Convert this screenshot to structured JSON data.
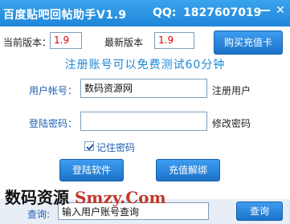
{
  "window": {
    "title": "百度贴吧回帖助手V1.9",
    "qq_label": "QQ:",
    "qq_value": "1827607019",
    "minimize_glyph": "—",
    "close_glyph": "✕"
  },
  "version": {
    "current_label": "当前版本：",
    "current_value": "1.9",
    "latest_label": "最新版本",
    "latest_value": "1.9",
    "buy_button": "购买充值卡"
  },
  "notice": "注册账号可以免费测试60分钟",
  "account": {
    "label": "用户帐号：",
    "value": "数码资源网",
    "register_link": "注册用户"
  },
  "password": {
    "label": "登陆密码：",
    "value": "",
    "modify_link": "修改密码"
  },
  "remember": {
    "label": "记住密码",
    "checked": true
  },
  "actions": {
    "login_button": "登陆软件",
    "recharge_button": "充值解绑"
  },
  "watermark": {
    "cn": "数码资源",
    "en": "Smzy.Com"
  },
  "query": {
    "label": "查询:",
    "value": "输入用户账号查询",
    "button": "查询"
  },
  "colors": {
    "titlebar": "#1f86d8",
    "button": "#1b73c8",
    "version_text": "#dd0000",
    "notice_text": "#1e88d8",
    "watermark_en": "#c0392b"
  },
  "icons": [
    "minimize-icon",
    "close-icon",
    "checkmark-icon"
  ]
}
